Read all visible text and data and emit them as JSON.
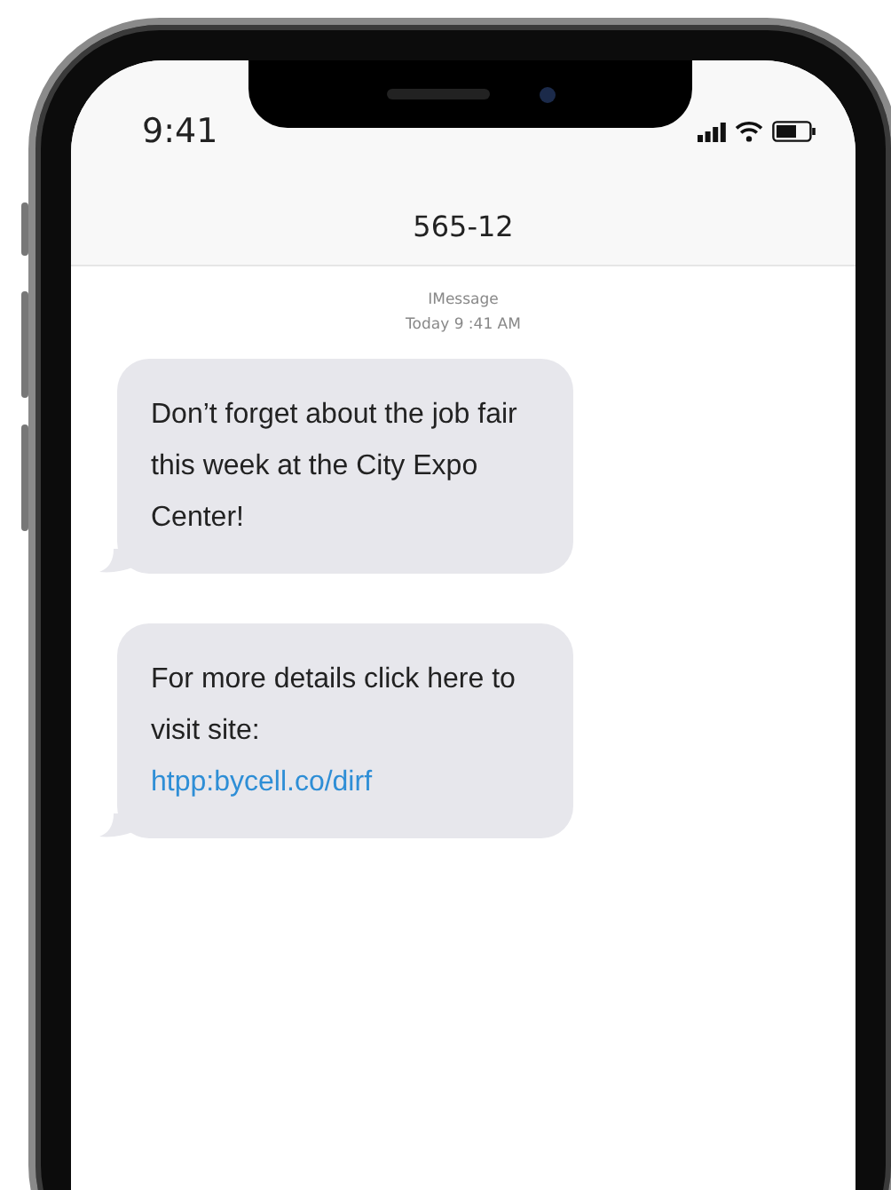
{
  "status_bar": {
    "time": "9:41"
  },
  "conversation": {
    "title": "565-12"
  },
  "service_label": "IMessage",
  "timestamp": "Today 9 :41 AM",
  "messages": [
    {
      "text": "Don’t forget about the job fair this week at the City Expo Center!"
    },
    {
      "text": "For more details click here to visit site:",
      "link": "htpp:bycell.co/dirf"
    }
  ]
}
